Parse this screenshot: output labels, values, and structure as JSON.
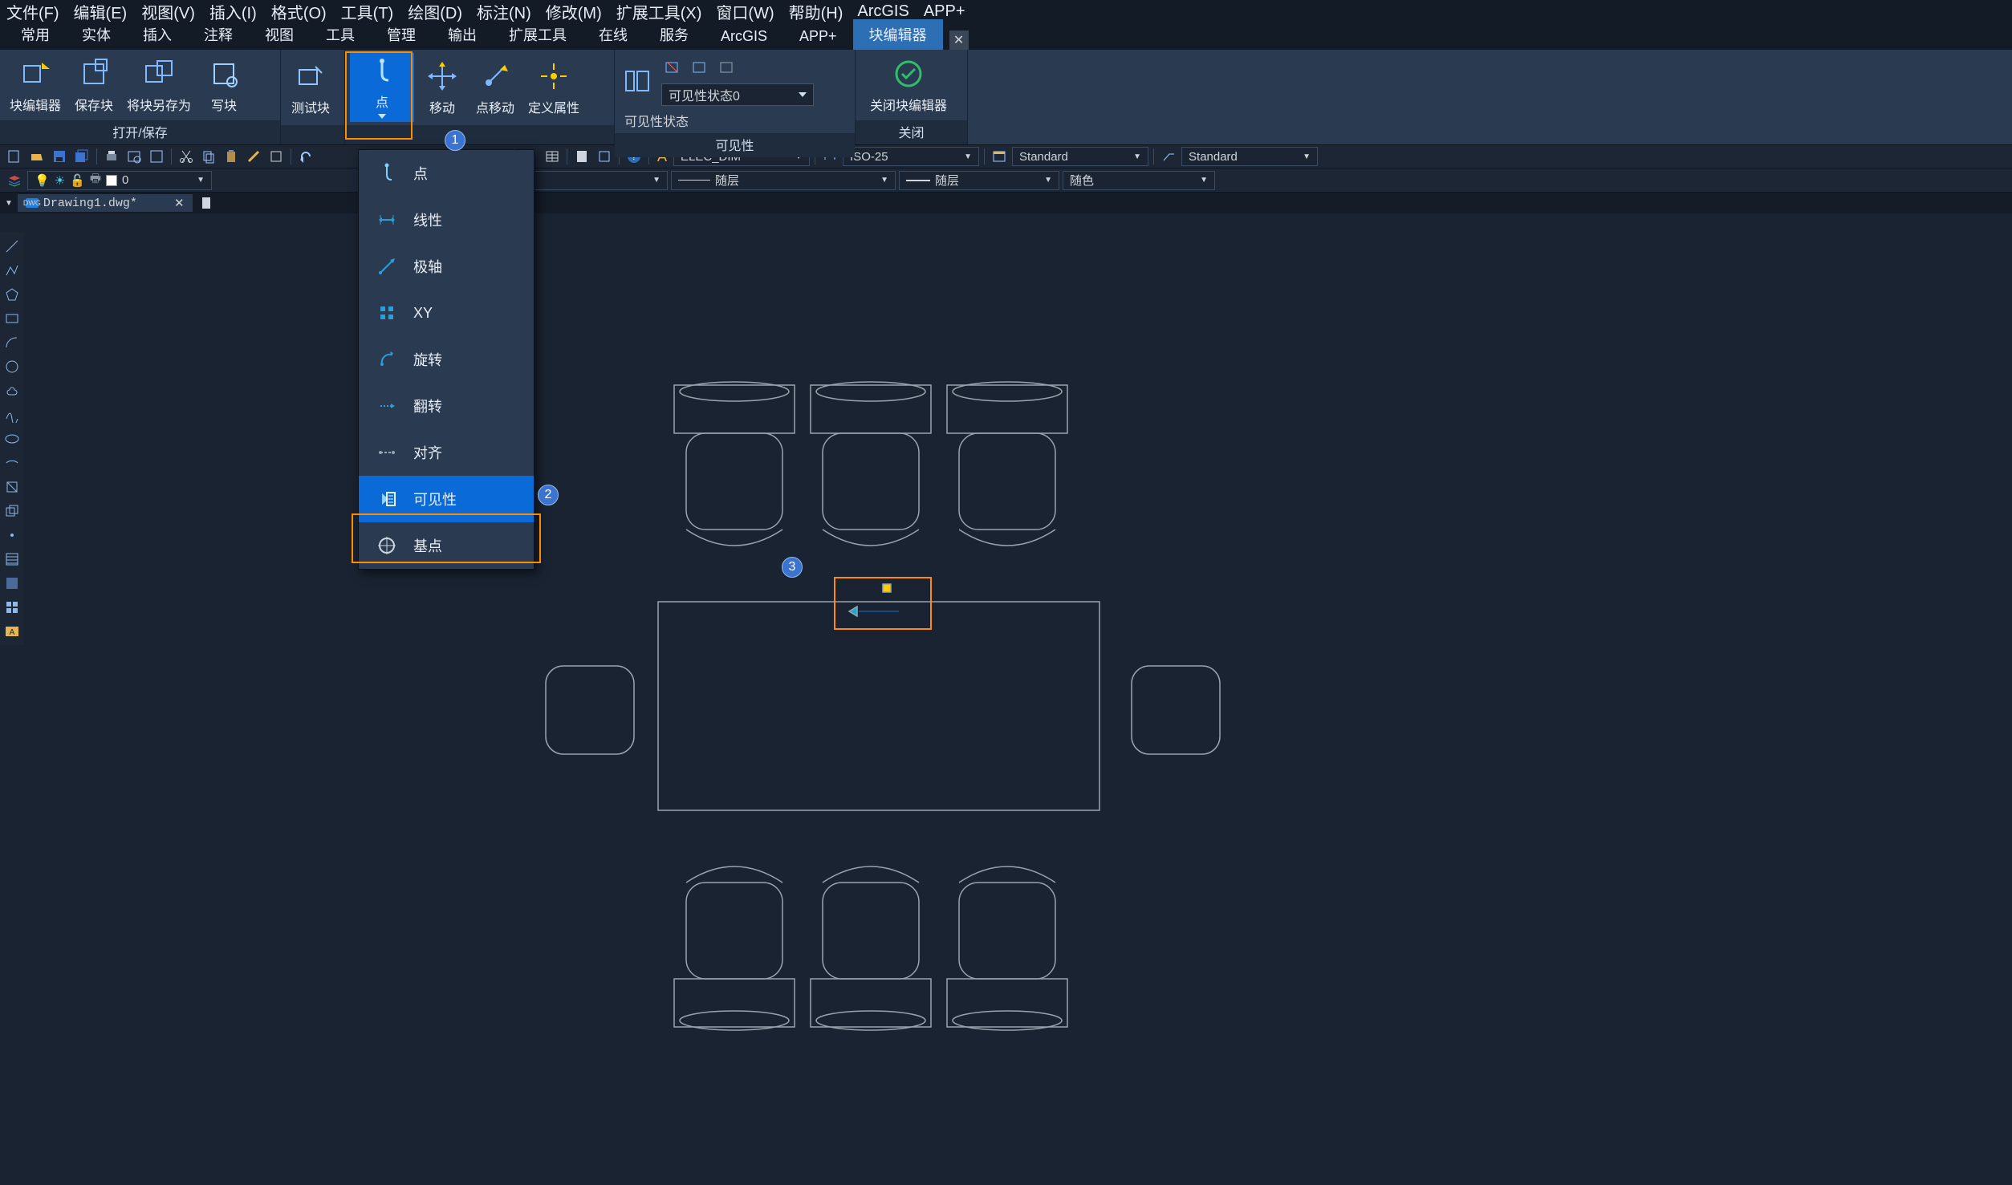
{
  "menubar": [
    "文件(F)",
    "编辑(E)",
    "视图(V)",
    "插入(I)",
    "格式(O)",
    "工具(T)",
    "绘图(D)",
    "标注(N)",
    "修改(M)",
    "扩展工具(X)",
    "窗口(W)",
    "帮助(H)",
    "ArcGIS",
    "APP+"
  ],
  "tabs": {
    "items": [
      "常用",
      "实体",
      "插入",
      "注释",
      "视图",
      "工具",
      "管理",
      "输出",
      "扩展工具",
      "在线",
      "服务",
      "ArcGIS",
      "APP+"
    ],
    "active": "块编辑器"
  },
  "ribbon": {
    "open_save": {
      "title": "打开/保存",
      "btns": [
        "块编辑器",
        "保存块",
        "将块另存为",
        "写块",
        "测试块"
      ]
    },
    "point": {
      "title": "",
      "btns": [
        "点",
        "移动",
        "点移动",
        "定义属性"
      ]
    },
    "vis": {
      "title": "可见性",
      "label": "可见性状态",
      "select": "可见性状态0"
    },
    "close": {
      "title": "关闭",
      "btn": "关闭块编辑器"
    }
  },
  "combos": {
    "dimstyle": "ELEC_DIM",
    "iso": "ISO-25",
    "std1": "Standard",
    "std2": "Standard",
    "layer_linetype": "随层",
    "layer_lineweight": "随层",
    "layer_plot": "随层",
    "layer_color": "随色"
  },
  "layerbox": {
    "name": "0"
  },
  "doctab": {
    "name": "Drawing1.dwg*"
  },
  "dropdown": {
    "items": [
      "点",
      "线性",
      "极轴",
      "XY",
      "旋转",
      "翻转",
      "对齐",
      "可见性",
      "基点"
    ],
    "selected_index": 7
  },
  "badges": {
    "b1": "1",
    "b2": "2",
    "b3": "3"
  }
}
